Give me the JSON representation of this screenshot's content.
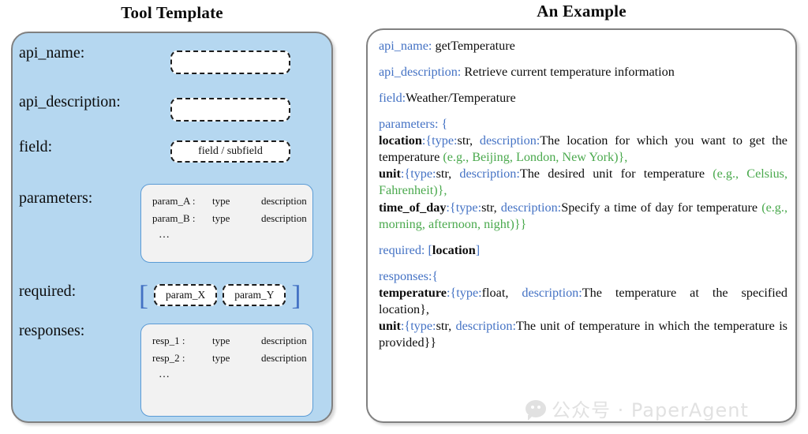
{
  "titles": {
    "left": "Tool Template",
    "right": "An Example"
  },
  "template": {
    "labels": {
      "api_name": "api_name:",
      "api_description": "api_description:",
      "field": "field:",
      "parameters": "parameters:",
      "required": "required:",
      "responses": "responses:"
    },
    "api_name_value": "",
    "api_description_value": "",
    "field_value": "field / subfield",
    "parameters_rows": [
      {
        "key": "param_A :",
        "type": "type",
        "desc": "description"
      },
      {
        "key": "param_B :",
        "type": "type",
        "desc": "description"
      }
    ],
    "parameters_ellipsis": "…",
    "required_chips": [
      "param_X",
      "param_Y"
    ],
    "bracket_open": "[",
    "bracket_close": "]",
    "responses_rows": [
      {
        "key": "resp_1 :",
        "type": "type",
        "desc": "description"
      },
      {
        "key": "resp_2 :",
        "type": "type",
        "desc": "description"
      }
    ],
    "responses_ellipsis": "…"
  },
  "example": {
    "api_name_label": "api_name:",
    "api_name_value": " getTemperature",
    "api_description_label": "api_description:",
    "api_description_value": " Retrieve current temperature information",
    "field_label": "field:",
    "field_value": "Weather/Temperature",
    "parameters_label": "parameters: {",
    "parameters": [
      {
        "name": "location",
        "open": ":{",
        "type_key": "type:",
        "type_value": "str, ",
        "desc_key": "description:",
        "desc_value": "The location for which you want to get the temperature ",
        "example": "(e.g., Beijing, London, New York)},"
      },
      {
        "name": "unit",
        "open": ":{",
        "type_key": "type:",
        "type_value": "str, ",
        "desc_key": "description:",
        "desc_value": "The desired unit for temperature ",
        "example": "(e.g., Celsius, Fahrenheit)},"
      },
      {
        "name": "time_of_day",
        "open": ":{",
        "type_key": "type:",
        "type_value": "str, ",
        "desc_key": "description:",
        "desc_value": "Specify a time of day  for temperature ",
        "example": "(e.g., morning, afternoon, night)}}"
      }
    ],
    "required_label": "required: ",
    "required_open": "[",
    "required_value": "location",
    "required_close": "]",
    "responses_label": "responses:{",
    "responses": [
      {
        "name": "temperature",
        "open": ":{",
        "type_key": "type:",
        "type_value": "float, ",
        "desc_key": "description:",
        "desc_value": "The temperature at the specified location},"
      },
      {
        "name": "unit",
        "open": ":{",
        "type_key": "type:",
        "type_value": "str, ",
        "desc_key": "description:",
        "desc_value": "The unit of temperature in which the temperature is provided}}"
      }
    ]
  },
  "watermark": {
    "text": "公众号 · PaperAgent"
  },
  "colors": {
    "panel_blue": "#b5d7f0",
    "panel_border": "#808080",
    "key_blue": "#4472c4",
    "example_green": "#4aa94d",
    "card_fill": "#f2f2f2",
    "card_border": "#5b9bd5"
  }
}
